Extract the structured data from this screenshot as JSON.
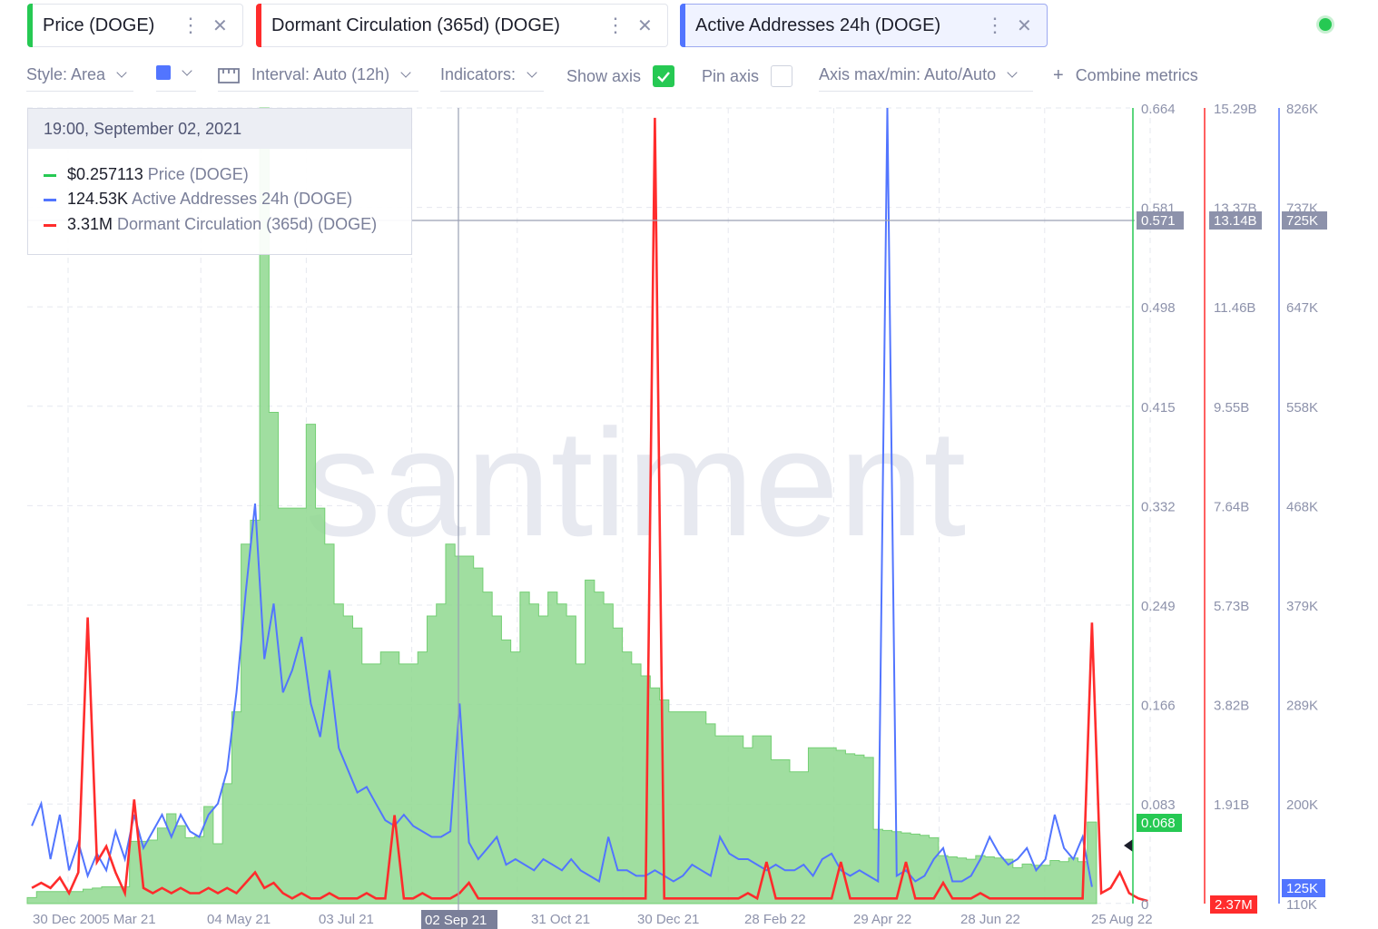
{
  "tabs": [
    {
      "label": "Price (DOGE)",
      "color": "#26c953"
    },
    {
      "label": "Dormant Circulation (365d) (DOGE)",
      "color": "#ff2c2c"
    },
    {
      "label": "Active Addresses 24h (DOGE)",
      "color": "#5275ff"
    }
  ],
  "toolbar": {
    "style": "Style: Area",
    "color": "#5275ff",
    "interval": "Interval: Auto (12h)",
    "indicators": "Indicators:",
    "show_axis": "Show axis",
    "show_axis_checked": true,
    "pin_axis": "Pin axis",
    "pin_axis_checked": false,
    "axis_maxmin": "Axis max/min: Auto/Auto",
    "combine": "Combine metrics"
  },
  "icons": {
    "tab_menu": "more-vertical-icon",
    "tab_close": "close-icon",
    "interval": "calendar-icon",
    "combine": "plus-icon",
    "dropdown": "chevron-down-icon"
  },
  "tooltip": {
    "date": "19:00, September 02, 2021",
    "rows": [
      {
        "value": "$0.257113",
        "name": "Price (DOGE)",
        "color": "#26c953"
      },
      {
        "value": "124.53K",
        "name": "Active Addresses 24h (DOGE)",
        "color": "#5275ff"
      },
      {
        "value": "3.31M",
        "name": "Dormant Circulation (365d) (DOGE)",
        "color": "#ff2c2c"
      }
    ]
  },
  "watermark": "santiment",
  "chart_data": {
    "type": "area",
    "x_ticks": [
      "30 Dec 20",
      "05 Mar 21",
      "04 May 21",
      "03 Jul 21",
      "02 Sep 21",
      "31 Oct 21",
      "30 Dec 21",
      "28 Feb 22",
      "29 Apr 22",
      "28 Jun 22",
      "25 Aug 22"
    ],
    "x_highlight": "02 Sep 21",
    "grid": true,
    "axes": [
      {
        "series": "Price (DOGE)",
        "color": "#26c953",
        "ticks": [
          "0.664",
          "0.581",
          "0.498",
          "0.415",
          "0.332",
          "0.249",
          "0.166",
          "0.083",
          "0"
        ],
        "ylim": [
          0,
          0.664
        ],
        "cursor_label": "0.571",
        "last_label": "0.068"
      },
      {
        "series": "Dormant Circulation (365d) (DOGE)",
        "color": "#ff2c2c",
        "ticks": [
          "15.29B",
          "13.37B",
          "11.46B",
          "9.55B",
          "7.64B",
          "5.73B",
          "3.82B",
          "1.91B"
        ],
        "cursor_label": "13.14B",
        "last_label": "2.37M"
      },
      {
        "series": "Active Addresses 24h (DOGE)",
        "color": "#5275ff",
        "ticks": [
          "826K",
          "737K",
          "647K",
          "558K",
          "468K",
          "379K",
          "289K",
          "200K",
          "110K"
        ],
        "cursor_label": "725K",
        "last_label": "125K"
      }
    ],
    "series": [
      {
        "name": "Price (DOGE)",
        "style": "area",
        "color": "#26c953",
        "values": [
          0.005,
          0.01,
          0.01,
          0.01,
          0.01,
          0.01,
          0.012,
          0.013,
          0.014,
          0.014,
          0.014,
          0.052,
          0.052,
          0.053,
          0.063,
          0.075,
          0.065,
          0.055,
          0.056,
          0.081,
          0.05,
          0.1,
          0.16,
          0.3,
          0.32,
          0.664,
          0.41,
          0.33,
          0.33,
          0.33,
          0.4,
          0.33,
          0.3,
          0.25,
          0.24,
          0.23,
          0.2,
          0.2,
          0.21,
          0.21,
          0.2,
          0.2,
          0.21,
          0.24,
          0.25,
          0.3,
          0.29,
          0.29,
          0.28,
          0.26,
          0.24,
          0.22,
          0.21,
          0.26,
          0.25,
          0.24,
          0.26,
          0.25,
          0.24,
          0.2,
          0.27,
          0.26,
          0.25,
          0.23,
          0.21,
          0.2,
          0.19,
          0.18,
          0.17,
          0.16,
          0.16,
          0.16,
          0.16,
          0.15,
          0.14,
          0.14,
          0.14,
          0.13,
          0.14,
          0.14,
          0.12,
          0.12,
          0.11,
          0.11,
          0.13,
          0.13,
          0.13,
          0.128,
          0.125,
          0.124,
          0.122,
          0.062,
          0.061,
          0.06,
          0.059,
          0.058,
          0.057,
          0.055,
          0.04,
          0.039,
          0.038,
          0.037,
          0.04,
          0.039,
          0.038,
          0.037,
          0.03,
          0.033,
          0.032,
          0.032,
          0.036,
          0.035,
          0.038,
          0.035,
          0.068
        ]
      },
      {
        "name": "Active Addresses 24h (DOGE)",
        "style": "line",
        "color": "#5275ff",
        "values": [
          180,
          200,
          150,
          190,
          140,
          165,
          135,
          155,
          140,
          175,
          150,
          190,
          160,
          175,
          190,
          170,
          190,
          175,
          170,
          190,
          200,
          230,
          300,
          390,
          470,
          330,
          380,
          300,
          320,
          350,
          290,
          260,
          320,
          250,
          230,
          210,
          215,
          200,
          185,
          180,
          190,
          180,
          175,
          170,
          170,
          175,
          290,
          165,
          150,
          160,
          170,
          145,
          150,
          145,
          140,
          150,
          145,
          140,
          150,
          140,
          135,
          130,
          170,
          140,
          140,
          135,
          135,
          140,
          135,
          130,
          135,
          145,
          140,
          135,
          170,
          155,
          150,
          150,
          145,
          140,
          145,
          140,
          140,
          145,
          135,
          150,
          155,
          140,
          135,
          140,
          135,
          130,
          826,
          135,
          140,
          130,
          135,
          150,
          160,
          130,
          130,
          135,
          150,
          170,
          155,
          145,
          150,
          160,
          140,
          150,
          190,
          160,
          150,
          170,
          125
        ]
      },
      {
        "name": "Dormant Circulation (365d) (DOGE)",
        "style": "line",
        "color": "#ff2c2c",
        "values": [
          0.3,
          0.4,
          0.3,
          0.5,
          0.2,
          0.6,
          5.5,
          0.8,
          1.1,
          0.6,
          0.2,
          2,
          0.3,
          0.2,
          0.3,
          0.2,
          0.3,
          0.2,
          0.2,
          0.3,
          0.2,
          0.3,
          0.2,
          0.4,
          0.6,
          0.3,
          0.4,
          0.2,
          0.1,
          0.2,
          0.1,
          0.1,
          0.2,
          0.1,
          0.1,
          0.1,
          0.2,
          0.1,
          0.1,
          1.7,
          0.1,
          0.1,
          0.2,
          0.1,
          0.1,
          0.1,
          0.2,
          0.4,
          0.1,
          0.1,
          0.1,
          0.1,
          0.1,
          0.1,
          0.1,
          0.1,
          0.1,
          0.1,
          0.1,
          0.1,
          0.1,
          0.1,
          0.1,
          0.1,
          0.1,
          0.1,
          0.1,
          15.1,
          0.1,
          0.1,
          0.1,
          0.1,
          0.1,
          0.1,
          0.1,
          0.1,
          0.1,
          0.2,
          0.1,
          0.8,
          0.1,
          0.1,
          0.1,
          0.1,
          0.1,
          0.1,
          0.1,
          0.8,
          0.1,
          0.1,
          0.1,
          0.1,
          0.1,
          0.1,
          0.8,
          0.1,
          0.1,
          0.1,
          0.4,
          0.1,
          0.1,
          0.1,
          0.2,
          0.1,
          0.1,
          0.1,
          0.1,
          0.1,
          0.1,
          0.1,
          0.1,
          0.1,
          0.1,
          0.1,
          5.4,
          0.2,
          0.3,
          0.6,
          0.2,
          0.1,
          0.05
        ]
      }
    ]
  }
}
